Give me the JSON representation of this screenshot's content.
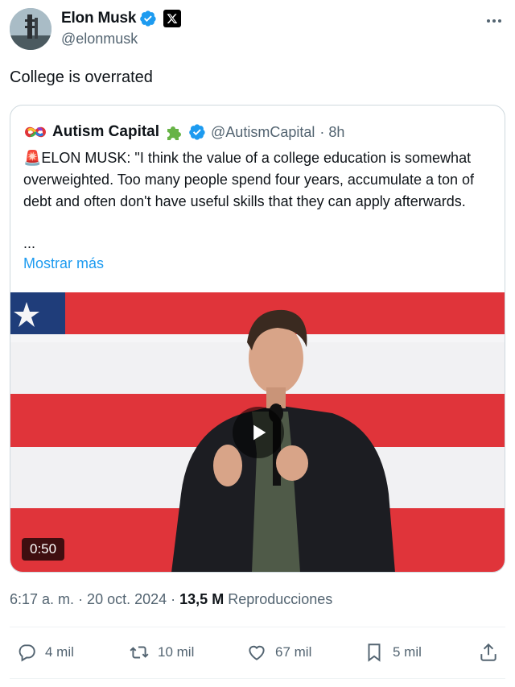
{
  "post": {
    "author_name": "Elon Musk",
    "author_handle": "@elonmusk",
    "text": "College is overrated",
    "more_icon": "more-dots-icon"
  },
  "quote": {
    "name": "Autism Capital",
    "handle": "@AutismCapital",
    "time": "· 8h",
    "text": "🚨ELON MUSK: \"I think the value of a college education is somewhat overweighted. Too many people spend four years, accumulate a ton of debt and often don't have useful skills that they can apply afterwards.",
    "ellipsis": "...",
    "show_more": "Mostrar más",
    "video_duration": "0:50"
  },
  "meta": {
    "time": "6:17 a. m.",
    "date": "· 20 oct. 2024 ·",
    "views": "13,5 M",
    "views_label": "Reproducciones"
  },
  "actions": {
    "replies": "4 mil",
    "reposts": "10 mil",
    "likes": "67 mil",
    "bookmarks": "5 mil"
  },
  "colors": {
    "accent": "#1d9bf0",
    "secondary_text": "#536471",
    "flag_red": "#e0343a"
  }
}
